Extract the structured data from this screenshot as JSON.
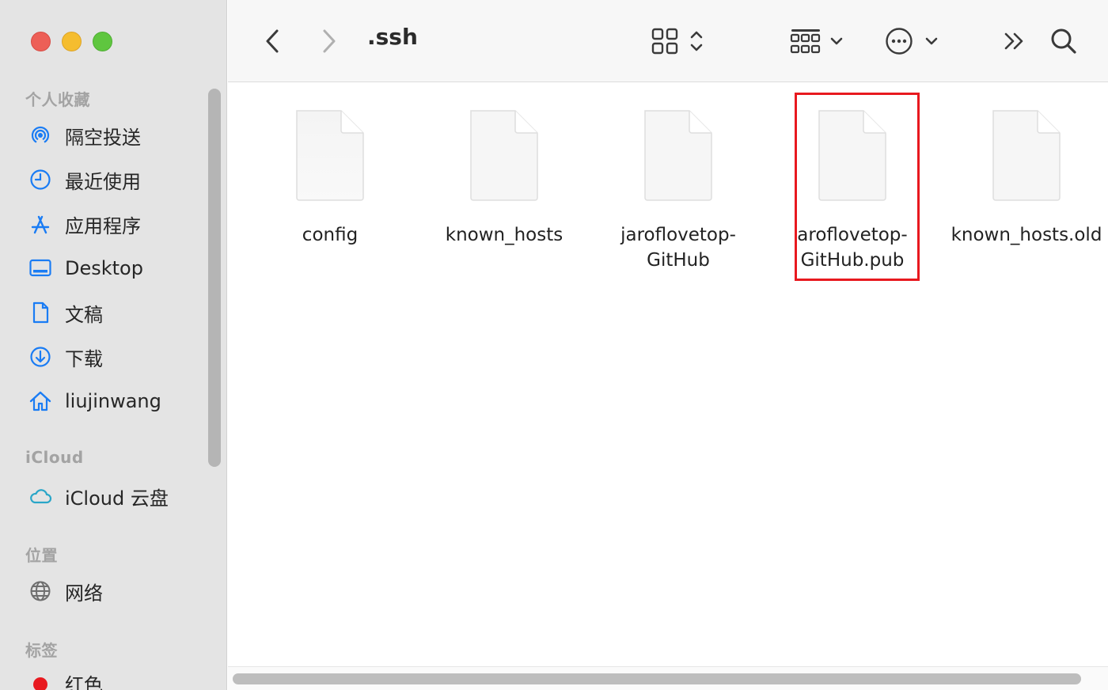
{
  "window": {
    "path_title": ".ssh"
  },
  "sidebar": {
    "favorites_title": "个人收藏",
    "favorites": [
      {
        "label": "隔空投送",
        "icon": "airdrop-icon"
      },
      {
        "label": "最近使用",
        "icon": "clock-icon"
      },
      {
        "label": "应用程序",
        "icon": "applications-icon"
      },
      {
        "label": "Desktop",
        "icon": "desktop-icon"
      },
      {
        "label": "文稿",
        "icon": "document-icon"
      },
      {
        "label": "下载",
        "icon": "download-icon"
      },
      {
        "label": "liujinwang",
        "icon": "home-icon"
      }
    ],
    "icloud_title": "iCloud",
    "icloud": [
      {
        "label": "iCloud 云盘",
        "icon": "cloud-icon"
      }
    ],
    "locations_title": "位置",
    "locations": [
      {
        "label": "网络",
        "icon": "globe-icon"
      }
    ],
    "tags_title": "标签",
    "tags": [
      {
        "label": "红色",
        "color": "#e8191f"
      }
    ]
  },
  "toolbar": {
    "back": "back-icon",
    "forward": "forward-icon",
    "view": "grid-view-icon",
    "group": "group-icon",
    "action": "more-actions-icon",
    "overflow": "chevron-double-right-icon",
    "search": "search-icon"
  },
  "files": [
    {
      "line1": "config",
      "line2": ""
    },
    {
      "line1": "known_hosts",
      "line2": ""
    },
    {
      "line1": "jaroflovetop-",
      "line2": "GitHub"
    },
    {
      "line1": "aroflovetop-",
      "line2": "GitHub.pub",
      "highlighted": true
    },
    {
      "line1": "known_hosts.old",
      "line2": ""
    }
  ],
  "colors": {
    "accent": "#1a7cf4",
    "highlight": "#e8191f"
  }
}
